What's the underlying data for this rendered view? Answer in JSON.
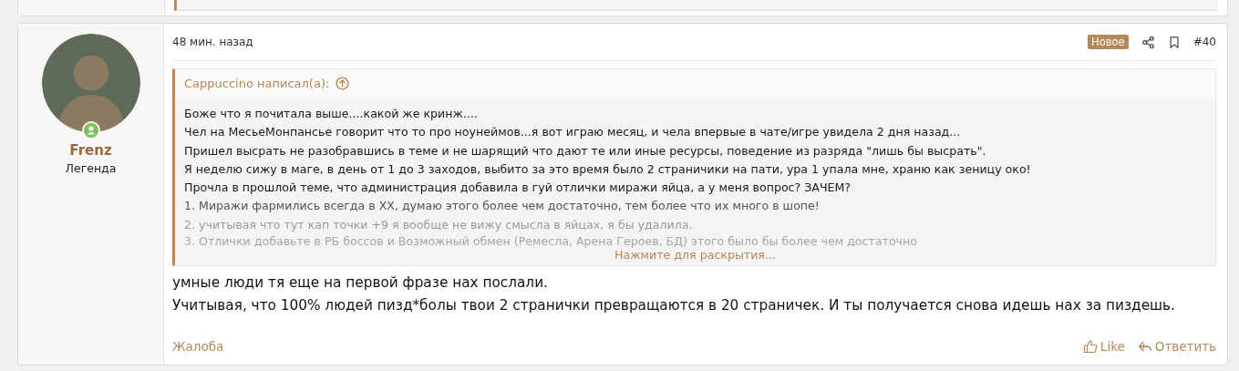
{
  "post": {
    "time": "48 мин. назад",
    "badge": "Новое",
    "number": "#40",
    "author": {
      "name": "Frenz",
      "title": "Легенда",
      "online": true
    },
    "quote": {
      "header": "Cappuccino написал(а):",
      "lines": [
        {
          "text": "Боже что я почитала выше....какой же кринж....",
          "kind": "normal"
        },
        {
          "text": "Чел на МесьеМонпансье говорит что то про ноунеймов...я вот играю месяц, и чела впервые в чате/игре увидела 2 дня назад...",
          "kind": "normal"
        },
        {
          "text": "Пришел высрать не разобравшись в теме и не шарящий что дают те или иные ресурсы, поведение из разряда \"лишь бы высрать\".",
          "kind": "normal"
        },
        {
          "text": "Я неделю сижу в маге, в день от 1 до 3 заходов, выбито за это время было 2 страничики на пати, ура 1 упала мне, храню как зеницу око!",
          "kind": "normal"
        },
        {
          "text": "Прочла в прошлой теме, что администрация добавила в гуй отлички миражи яйца, а у меня вопрос? ЗАЧЕМ?",
          "kind": "normal"
        },
        {
          "text": "1. Миражи фармились всегда в ХХ, думаю этого более чем достаточно, тем более что их много в шопе!",
          "kind": "dim"
        },
        {
          "text": "2. учитывая что тут кап точки +9 я вообще не вижу смысла в яйцах, я бы удалила.",
          "kind": "faint"
        },
        {
          "text": "3. Отлички добавьте в РБ боссов и Возможный обмен (Ремесла, Арена Героев, БД) этого было бы более чем достаточно",
          "kind": "ghost"
        }
      ],
      "expand": "Нажмите для раскрытия..."
    },
    "body": [
      "умные люди тя еще на первой фразе нах послали.",
      "Учитывая, что 100% людей пизд*болы твои 2 странички превращаются в 20 страничек. И ты получается снова идешь нах за пиздешь."
    ],
    "report": "Жалоба",
    "like": "Like",
    "reply": "Ответить"
  }
}
